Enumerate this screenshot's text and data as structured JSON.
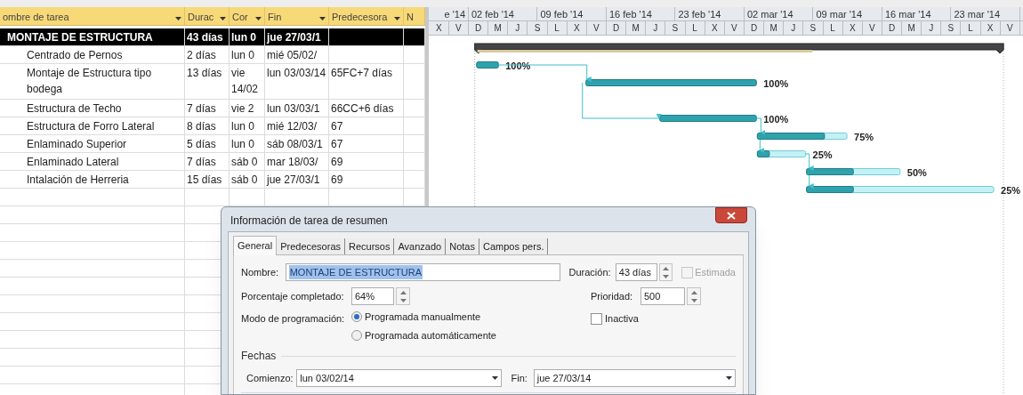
{
  "table": {
    "columns": [
      "ombre de tarea",
      "Durac",
      "Cor",
      "Fin",
      "Predecesora",
      "N"
    ],
    "rows": [
      {
        "name": "MONTAJE DE ESTRUCTURA",
        "duration": "43 días",
        "start": "lun 0",
        "finish": "jue 27/03/1",
        "selected": true,
        "level": 0.64,
        "children": [
          {
            "name": "Centrado de Pernos",
            "duration": "2 días",
            "start": "lun 0",
            "finish": "mié 05/02/",
            "selected": false,
            "level": 1,
            "label": "100%"
          },
          {
            "name": "Montaje de Estructura tipo bodega",
            "duration": "13 días",
            "start": "vie 14/02",
            "finish": "lun 03/03/14",
            "predecessors": "65FC+7 días",
            "selected": false,
            "level": 1,
            "label": "100%"
          },
          {
            "name": "Estructura de Techo",
            "duration": "7 días",
            "start": "vie 2",
            "finish": "lun 03/03/1",
            "predecessors": "66CC+6 días",
            "selected": false,
            "level": 1,
            "label": "100%"
          },
          {
            "name": "Estructura de Forro Lateral",
            "duration": "8 días",
            "start": "lun 0",
            "finish": "mié 12/03/",
            "predecessors": "67",
            "selected": false,
            "level": 0.75,
            "label": "75%"
          },
          {
            "name": "Enlaminado Superior",
            "duration": "5 días",
            "start": "lun 0",
            "finish": "sáb 08/03/1",
            "predecessors": "67",
            "selected": false,
            "level": 0.25,
            "label": "25%"
          },
          {
            "name": "Enlaminado Lateral",
            "duration": "7 días",
            "start": "sáb 0",
            "finish": "mar 18/03/",
            "predecessors": "69",
            "selected": false,
            "level": 0.5,
            "label": "50%"
          },
          {
            "name": "Intalación de Herreria",
            "duration": "15 días",
            "start": "sáb 0",
            "finish": "jue 27/03/1",
            "predecessors": "69",
            "selected": false,
            "level": 0.25,
            "label": "25%"
          }
        ]
      }
    ]
  },
  "timescale": {
    "weeks": [
      "e '14",
      "02 feb '14",
      "09 feb '14",
      "16 feb '14",
      "23 feb '14",
      "02 mar '14",
      "09 mar '14",
      "16 mar '14",
      "23 mar '14"
    ],
    "days": [
      "X",
      "V",
      "D",
      "M",
      "J",
      "S",
      "L",
      "X",
      "V",
      "D",
      "M",
      "J",
      "S",
      "L",
      "X",
      "V",
      "D",
      "M",
      "J",
      "S",
      "L",
      "X",
      "V",
      "D",
      "M",
      "J",
      "S",
      "L",
      "X",
      "V"
    ]
  },
  "dialog": {
    "title": "Información de tarea de resumen",
    "tabs": [
      {
        "label": "General",
        "selected": true
      },
      {
        "label": "Predecesoras",
        "selected": false
      },
      {
        "label": "Recursos",
        "selected": false
      },
      {
        "label": "Avanzado",
        "selected": false
      },
      {
        "label": "Notas",
        "selected": false
      },
      {
        "label": "Campos pers.",
        "selected": false
      }
    ],
    "name": {
      "label": "Nombre:",
      "value": "MONTAJE DE ESTRUCTURA"
    },
    "duration": {
      "label": "Duración:",
      "value": "43 días"
    },
    "estimated": {
      "label": "Estimada",
      "checked": false,
      "disabled": true
    },
    "percent": {
      "label": "Porcentaje completado:",
      "value": "64%"
    },
    "priority": {
      "label": "Prioridad:",
      "value": "500"
    },
    "mode": {
      "label": "Modo de programación:",
      "options": [
        {
          "label": "Programada manualmente",
          "selected": true
        },
        {
          "label": "Programada automáticamente",
          "selected": false
        }
      ]
    },
    "inactive": {
      "label": "Inactiva",
      "checked": false
    },
    "dates": {
      "label": "Fechas",
      "start_label": "Comienzo:",
      "start_value": "lun 03/02/14",
      "finish_label": "Fin:",
      "finish_value": "jue 27/03/14"
    }
  }
}
